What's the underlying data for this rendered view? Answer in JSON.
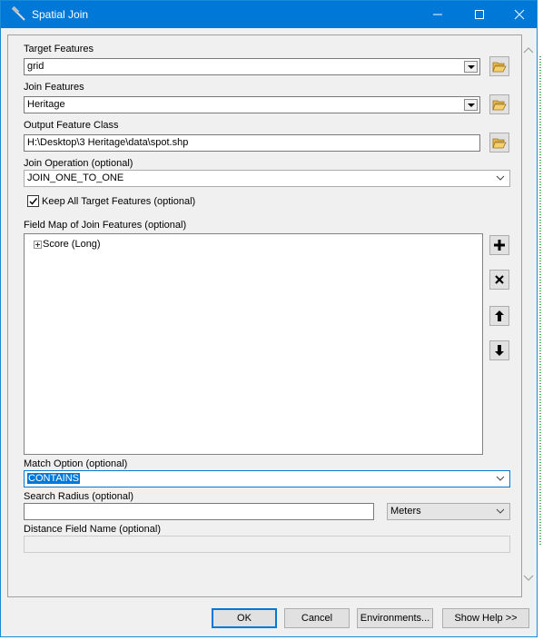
{
  "window": {
    "title": "Spatial Join"
  },
  "target_features": {
    "label": "Target Features",
    "value": "grid"
  },
  "join_features": {
    "label": "Join Features",
    "value": "Heritage"
  },
  "output_feature_class": {
    "label": "Output Feature Class",
    "value": "H:\\Desktop\\3 Heritage\\data\\spot.shp"
  },
  "join_operation": {
    "label": "Join Operation (optional)",
    "value": "JOIN_ONE_TO_ONE"
  },
  "keep_all": {
    "label": "Keep All Target Features (optional)",
    "checked": true
  },
  "field_map": {
    "label": "Field Map of Join Features (optional)",
    "items": [
      {
        "label": "Score (Long)",
        "expander": "+"
      }
    ]
  },
  "match_option": {
    "label": "Match Option (optional)",
    "value": "CONTAINS"
  },
  "search_radius": {
    "label": "Search Radius (optional)",
    "value": "",
    "unit": "Meters"
  },
  "distance_field": {
    "label": "Distance Field Name (optional)",
    "value": ""
  },
  "buttons": {
    "ok": "OK",
    "cancel": "Cancel",
    "environments": "Environments...",
    "show_help": "Show Help >>"
  },
  "side_icons": [
    "add-icon",
    "remove-icon",
    "move-up-icon",
    "move-down-icon"
  ],
  "colors": {
    "titlebar": "#0078d7",
    "selection": "#0078d7"
  }
}
